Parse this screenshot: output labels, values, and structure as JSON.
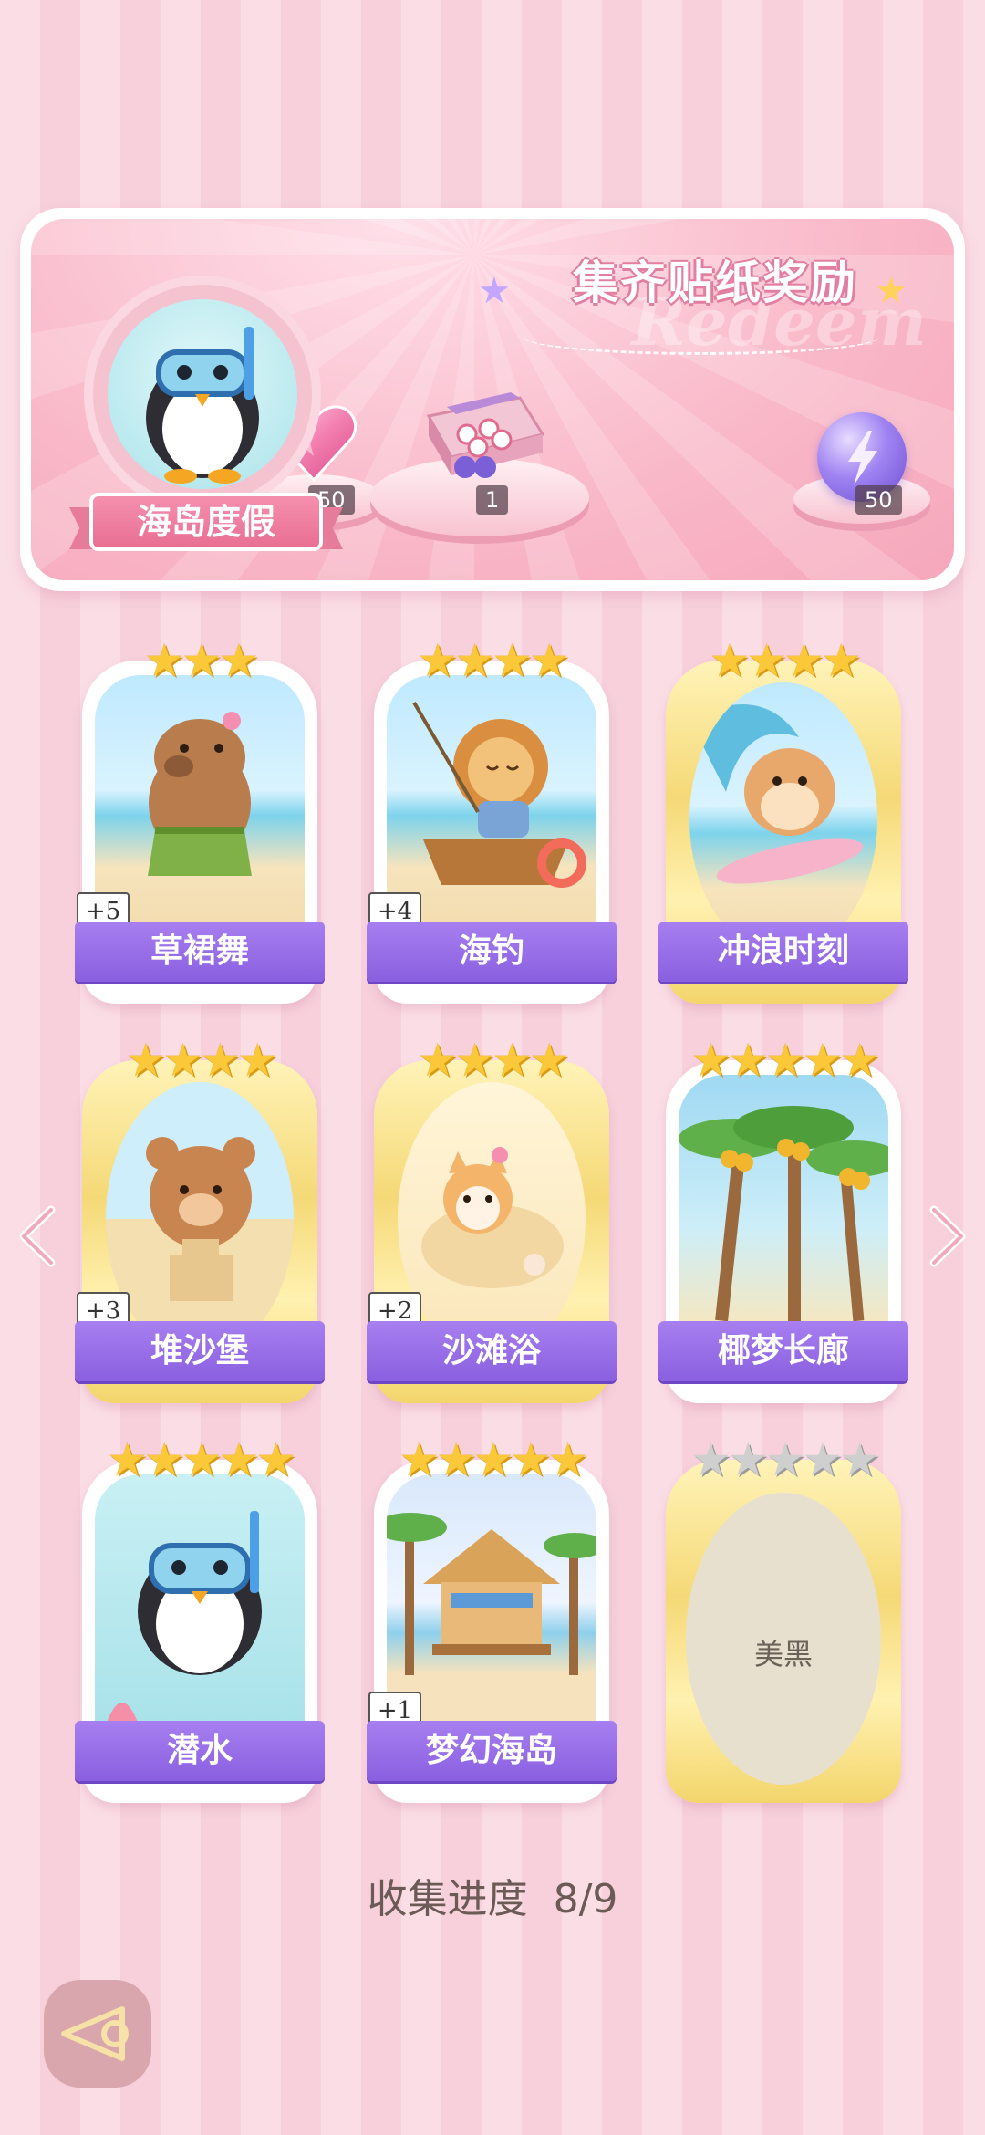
{
  "banner": {
    "title": "集齐贴纸奖励",
    "watermark": "Redeem",
    "avatar_label": "海岛度假",
    "rewards": [
      {
        "icon": "pink-heart-gem-icon",
        "count": "50"
      },
      {
        "icon": "gift-box-icon",
        "count": "1"
      },
      {
        "icon": "purple-energy-orb-icon",
        "count": "50"
      }
    ]
  },
  "cards": [
    {
      "name": "草裙舞",
      "stars": 3,
      "max_stars": 3,
      "badge": "+5",
      "art": "capybara-hula-dance"
    },
    {
      "name": "海钓",
      "stars": 4,
      "max_stars": 4,
      "badge": "+4",
      "art": "lion-fishing-boat"
    },
    {
      "name": "冲浪时刻",
      "stars": 4,
      "max_stars": 4,
      "badge": "",
      "art": "hamster-surfing"
    },
    {
      "name": "堆沙堡",
      "stars": 4,
      "max_stars": 4,
      "badge": "+3",
      "art": "bear-sandcastle"
    },
    {
      "name": "沙滩浴",
      "stars": 4,
      "max_stars": 4,
      "badge": "+2",
      "art": "cat-sand-bath"
    },
    {
      "name": "椰梦长廊",
      "stars": 5,
      "max_stars": 5,
      "badge": "",
      "art": "coconut-palms"
    },
    {
      "name": "潜水",
      "stars": 5,
      "max_stars": 5,
      "badge": "",
      "art": "penguin-snorkel"
    },
    {
      "name": "梦幻海岛",
      "stars": 5,
      "max_stars": 5,
      "badge": "+1",
      "art": "beach-hut"
    },
    {
      "name": "美黑",
      "stars": 0,
      "max_stars": 5,
      "badge": "",
      "art": "locked",
      "locked": true
    }
  ],
  "progress": {
    "label": "收集进度",
    "value": "8/9",
    "collected": 8,
    "total": 9
  },
  "colors": {
    "name_plate": "#8a5fe0",
    "star": "#fbc839",
    "background": "#fbdde6"
  }
}
